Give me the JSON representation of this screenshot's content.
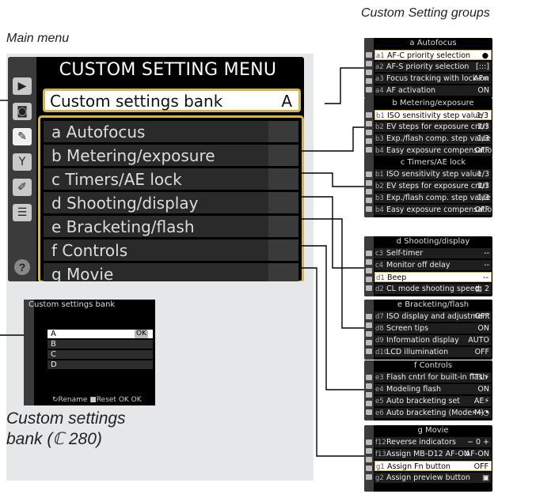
{
  "captions": {
    "groups": "Custom Setting groups",
    "main": "Main menu",
    "bank_line1": "Custom settings",
    "bank_line2": "bank (ℂ 280)"
  },
  "main_menu": {
    "title": "CUSTOM SETTING MENU",
    "bank_label": "Custom settings bank",
    "bank_value": "A",
    "groups": [
      {
        "letter": "a",
        "label": "Autofocus"
      },
      {
        "letter": "b",
        "label": "Metering/exposure"
      },
      {
        "letter": "c",
        "label": "Timers/AE lock"
      },
      {
        "letter": "d",
        "label": "Shooting/display"
      },
      {
        "letter": "e",
        "label": "Bracketing/flash"
      },
      {
        "letter": "f",
        "label": "Controls"
      },
      {
        "letter": "g",
        "label": "Movie"
      }
    ],
    "side_icons": [
      "play-icon",
      "camera-icon",
      "pencil-icon",
      "wrench-icon",
      "retouch-icon",
      "my-menu-icon"
    ],
    "help": "?"
  },
  "bank_screen": {
    "title": "Custom settings bank",
    "rows": [
      "A",
      "B",
      "C",
      "D"
    ],
    "selected_mark": "OK",
    "footer": "↻Rename ■Reset OK OK"
  },
  "group_screens": [
    {
      "title": "a Autofocus",
      "rows": [
        {
          "code": "a1",
          "label": "AF-C priority selection",
          "value": "●",
          "hl": true
        },
        {
          "code": "a2",
          "label": "AF-S priority selection",
          "value": "[:::]",
          "hl": false
        },
        {
          "code": "a3",
          "label": "Focus tracking with lock-on",
          "value": "AF≡",
          "hl": false
        },
        {
          "code": "a4",
          "label": "AF activation",
          "value": "ON",
          "hl": false
        }
      ]
    },
    {
      "title": "b Metering/exposure",
      "rows": [
        {
          "code": "b1",
          "label": "ISO sensitivity step value",
          "value": "1/3",
          "hl": true
        },
        {
          "code": "b2",
          "label": "EV steps for exposure cntrl",
          "value": "1/3",
          "hl": false
        },
        {
          "code": "b3",
          "label": "Exp./flash comp. step value",
          "value": "1/3",
          "hl": false
        },
        {
          "code": "b4",
          "label": "Easy exposure compensation",
          "value": "OFF",
          "hl": false
        }
      ]
    },
    {
      "title": "c Timers/AE lock",
      "rows": [
        {
          "code": "b1",
          "label": "ISO sensitivity step value",
          "value": "1/3",
          "hl": false
        },
        {
          "code": "b2",
          "label": "EV steps for exposure cntrl",
          "value": "1/3",
          "hl": false
        },
        {
          "code": "b3",
          "label": "Exp./flash comp. step value",
          "value": "1/3",
          "hl": false
        },
        {
          "code": "b4",
          "label": "Easy exposure compensation",
          "value": "OFF",
          "hl": false
        }
      ]
    },
    {
      "title": "d Shooting/display",
      "rows": [
        {
          "code": "c3",
          "label": "Self-timer",
          "value": "--",
          "hl": false
        },
        {
          "code": "c4",
          "label": "Monitor off delay",
          "value": "--",
          "hl": false
        },
        {
          "code": "d1",
          "label": "Beep",
          "value": "--",
          "hl": true
        },
        {
          "code": "d2",
          "label": "CL mode shooting speed",
          "value": "▤ 2",
          "hl": false
        }
      ]
    },
    {
      "title": "e Bracketing/flash",
      "rows": [
        {
          "code": "d7",
          "label": "ISO display and adjustment",
          "value": "OFF",
          "hl": false
        },
        {
          "code": "d8",
          "label": "Screen tips",
          "value": "ON",
          "hl": false
        },
        {
          "code": "d9",
          "label": "Information display",
          "value": "AUTO",
          "hl": false
        },
        {
          "code": "d10",
          "label": "LCD illumination",
          "value": "OFF",
          "hl": false
        }
      ]
    },
    {
      "title": "f Controls",
      "rows": [
        {
          "code": "e3",
          "label": "Flash cntrl for built-in flash",
          "value": "TTL⚡",
          "hl": false
        },
        {
          "code": "e4",
          "label": "Modeling flash",
          "value": "ON",
          "hl": false
        },
        {
          "code": "e5",
          "label": "Auto bracketing set",
          "value": "AE⚡",
          "hl": false
        },
        {
          "code": "e6",
          "label": "Auto bracketing (Mode M)",
          "value": "⚡+◔",
          "hl": false
        }
      ]
    },
    {
      "title": "g Movie",
      "rows": [
        {
          "code": "f12",
          "label": "Reverse indicators",
          "value": "− 0 +",
          "hl": false
        },
        {
          "code": "f13",
          "label": "Assign MB-D12 AF-ON",
          "value": "AF-ON",
          "hl": false
        },
        {
          "code": "g1",
          "label": "Assign Fn button",
          "value": "OFF",
          "hl": true
        },
        {
          "code": "g2",
          "label": "Assign preview button",
          "value": "▣",
          "hl": false
        }
      ]
    }
  ]
}
